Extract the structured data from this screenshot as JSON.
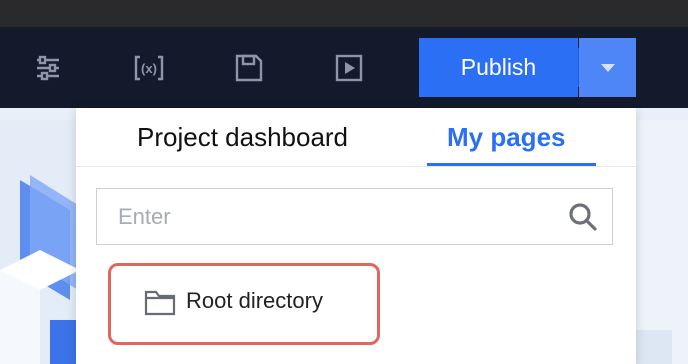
{
  "toolbar": {
    "icons": [
      "settings-sliders-icon",
      "variables-icon",
      "save-icon",
      "preview-play-icon"
    ],
    "publish_label": "Publish"
  },
  "dropdown": {
    "tabs": [
      {
        "label": "Project dashboard",
        "active": false
      },
      {
        "label": "My pages",
        "active": true
      }
    ],
    "search": {
      "placeholder": "Enter",
      "value": ""
    },
    "tree": [
      {
        "label": "Root directory",
        "icon": "folder-icon"
      }
    ]
  },
  "colors": {
    "accent": "#2b6ff5",
    "highlight_border": "#e0685a",
    "toolbar_bg": "#131a2b"
  }
}
